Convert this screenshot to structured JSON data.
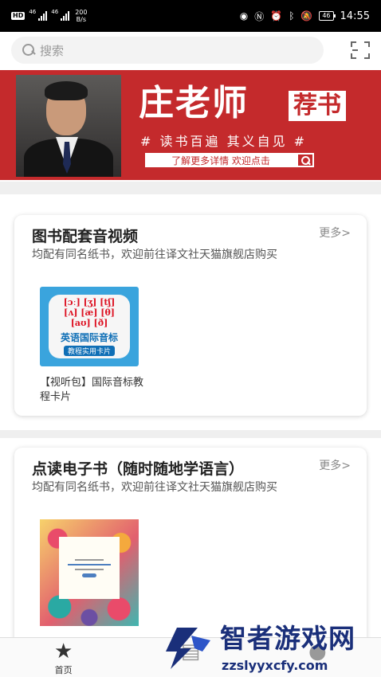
{
  "status_bar": {
    "hd_label": "HD",
    "net1": "46",
    "net2": "46",
    "speed_value": "200",
    "speed_unit": "B/s",
    "battery": "46",
    "time": "14:55"
  },
  "search": {
    "placeholder": "搜索"
  },
  "banner": {
    "title": "庄老师",
    "tag": "荐书",
    "subtitle": "# 读书百遍 其义自见 #",
    "button_label": "了解更多详情 欢迎点击"
  },
  "sections": [
    {
      "title": "图书配套音视频",
      "more": "更多>",
      "description": "均配有同名纸书，欢迎前往译文社天猫旗舰店购买",
      "books": [
        {
          "name": "【视听包】国际音标教程卡片",
          "cover_symbols_1": "[ɔː] [ʒ] [tʃ]",
          "cover_symbols_2": "[ʌ] [æ] [θ]",
          "cover_symbols_3": "[aʊ] [ð]",
          "cover_title": "英语国际音标",
          "cover_subtitle": "教程实用卡片"
        }
      ]
    },
    {
      "title": "点读电子书（随时随地学语言）",
      "more": "更多>",
      "description": "均配有同名纸书，欢迎前往译文社天猫旗舰店购买",
      "books": [
        {
          "name": ""
        }
      ]
    }
  ],
  "tabbar": {
    "items": [
      {
        "label": "首页",
        "icon": "star-icon"
      },
      {
        "label": "",
        "icon": "bookshelf-icon"
      },
      {
        "label": "",
        "icon": "user-icon"
      }
    ]
  },
  "watermark": {
    "title": "智者游戏网",
    "url": "zzslyyxcfy.com"
  },
  "colors": {
    "banner_red": "#c42a2c",
    "watermark_blue": "#1a2f7a"
  }
}
